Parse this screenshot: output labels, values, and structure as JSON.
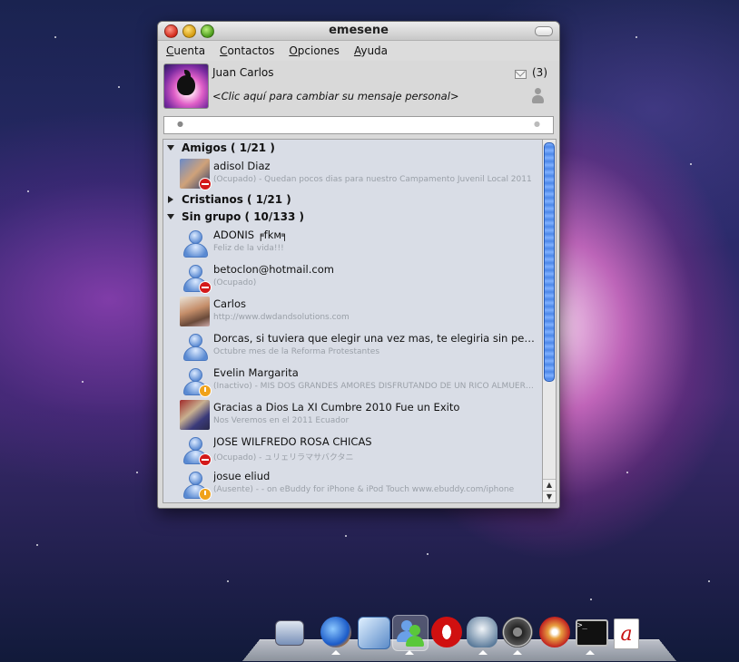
{
  "window": {
    "title": "emesene"
  },
  "menu": [
    "Cuenta",
    "Contactos",
    "Opciones",
    "Ayuda"
  ],
  "profile": {
    "nick": "Juan Carlos",
    "personal_message": "<Clic aquí para cambiar su mensaje personal>",
    "mail_count": "(3)"
  },
  "groups": [
    {
      "label": "Amigos ( 1/21 )",
      "expanded": true
    },
    {
      "label": "Cristianos ( 1/21 )",
      "expanded": false
    },
    {
      "label": "Sin grupo ( 10/133 )",
      "expanded": true
    }
  ],
  "contacts": [
    {
      "name": "adisol Diaz",
      "message": "(Ocupado) - Quedan pocos dias para nuestro Campamento Juvenil Local 2011",
      "status": "busy",
      "picture": "photo"
    },
    {
      "name": "ADONIS ╒fkм╕",
      "message": "Feliz de la vida!!!",
      "status": "online",
      "picture": "default-avatar"
    },
    {
      "name": "betoclon@hotmail.com",
      "message": "(Ocupado)",
      "status": "busy",
      "picture": "default-avatar"
    },
    {
      "name": "Carlos",
      "message": "http://www.dwdandsolutions.com",
      "status": "online",
      "picture": "photo"
    },
    {
      "name": "Dorcas, si tuviera que elegir una vez mas, te elegiria sin pensarlo",
      "message": "Octubre mes de la Reforma Protestantes",
      "status": "online",
      "picture": "default-avatar"
    },
    {
      "name": "Evelin Margarita",
      "message": "(Inactivo) - MIS DOS GRANDES AMORES DISFRUTANDO DE UN RICO ALMUERZO",
      "status": "idle",
      "picture": "default-avatar"
    },
    {
      "name": "Gracias a Dios La XI Cumbre 2010 Fue un Exito",
      "message": "Nos Veremos en el 2011 Ecuador",
      "status": "online",
      "picture": "photo"
    },
    {
      "name": "JOSE WILFREDO ROSA CHICAS",
      "message": "(Ocupado) - ュリェリラマサバクタニ",
      "status": "busy",
      "picture": "default-avatar"
    },
    {
      "name": "josue eliud",
      "message": "(Ausente) -    - on eBuddy for iPhone & iPod Touch www.ebuddy.com/iphone",
      "status": "away",
      "picture": "default-avatar"
    }
  ],
  "dock": [
    "network-icon",
    "browser-icon",
    "cube-icon",
    "emesene-icon",
    "opera-icon",
    "elephant-icon",
    "disk-utility-icon",
    "burner-icon",
    "terminal-icon",
    "pdf-reader-icon"
  ],
  "colors": {
    "busy": "#d3191a",
    "away": "#f0a21a",
    "list_bg": "#d9dde6",
    "accent": "#4e88e8"
  }
}
